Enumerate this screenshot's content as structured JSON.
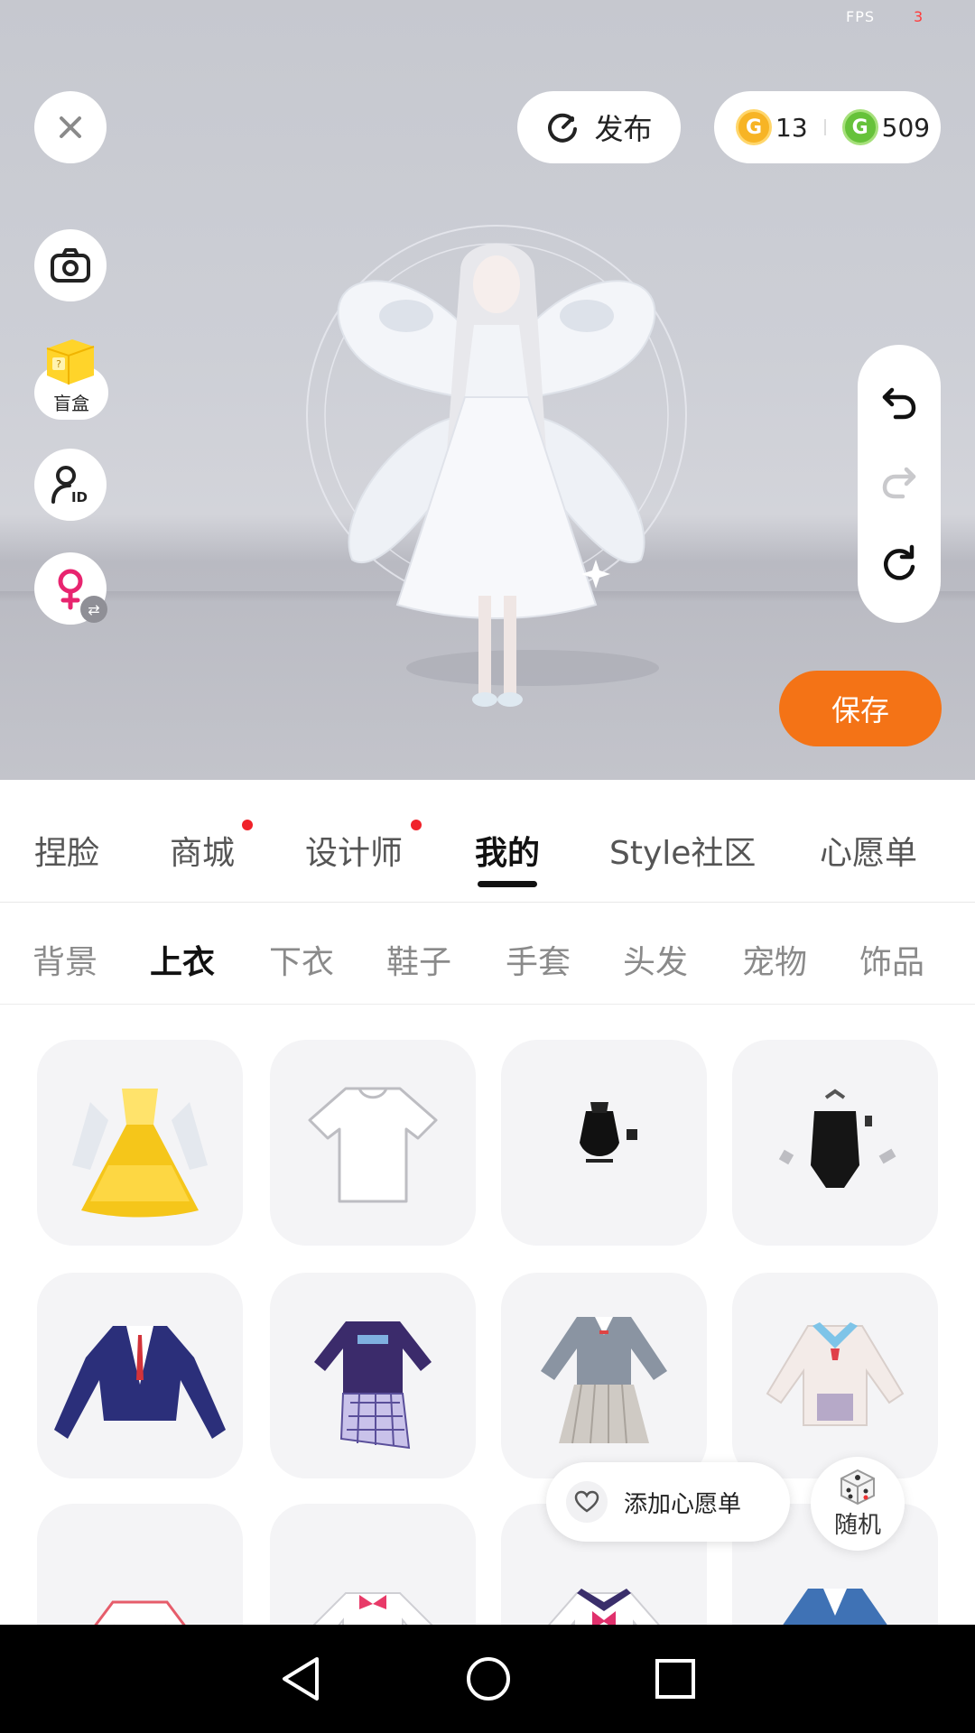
{
  "status": {
    "fps_label": "FPS",
    "fps_value": "3"
  },
  "toolbar": {
    "publish_label": "发布",
    "gold_coins": "13",
    "green_coins": "509",
    "save_label": "保存",
    "blind_box_label": "盲盒",
    "add_wishlist_label": "添加心愿单",
    "random_label": "随机"
  },
  "tabs": [
    {
      "label": "捏脸",
      "active": false,
      "badge": false
    },
    {
      "label": "商城",
      "active": false,
      "badge": true
    },
    {
      "label": "设计师",
      "active": false,
      "badge": true
    },
    {
      "label": "我的",
      "active": true,
      "badge": false
    },
    {
      "label": "Style社区",
      "active": false,
      "badge": false
    },
    {
      "label": "心愿单",
      "active": false,
      "badge": false
    }
  ],
  "categories": [
    {
      "label": "背景",
      "active": false
    },
    {
      "label": "上衣",
      "active": true
    },
    {
      "label": "下衣",
      "active": false
    },
    {
      "label": "鞋子",
      "active": false
    },
    {
      "label": "手套",
      "active": false
    },
    {
      "label": "头发",
      "active": false
    },
    {
      "label": "宠物",
      "active": false
    },
    {
      "label": "饰品",
      "active": false
    }
  ],
  "items": [
    {
      "name": "yellow-gown"
    },
    {
      "name": "white-tshirt"
    },
    {
      "name": "black-corset-top"
    },
    {
      "name": "black-bodysuit"
    },
    {
      "name": "navy-blazer"
    },
    {
      "name": "purple-sweater-plaid"
    },
    {
      "name": "grey-school-uniform"
    },
    {
      "name": "white-sailor-cardigan"
    },
    {
      "name": "red-outline-shirt"
    },
    {
      "name": "white-bow-shirt"
    },
    {
      "name": "white-sailor-shirt"
    },
    {
      "name": "blue-jacket"
    }
  ],
  "colors": {
    "accent": "#f47316",
    "badge": "#f0222a",
    "coin_gold": "#f7b425",
    "coin_green": "#66c23a"
  }
}
